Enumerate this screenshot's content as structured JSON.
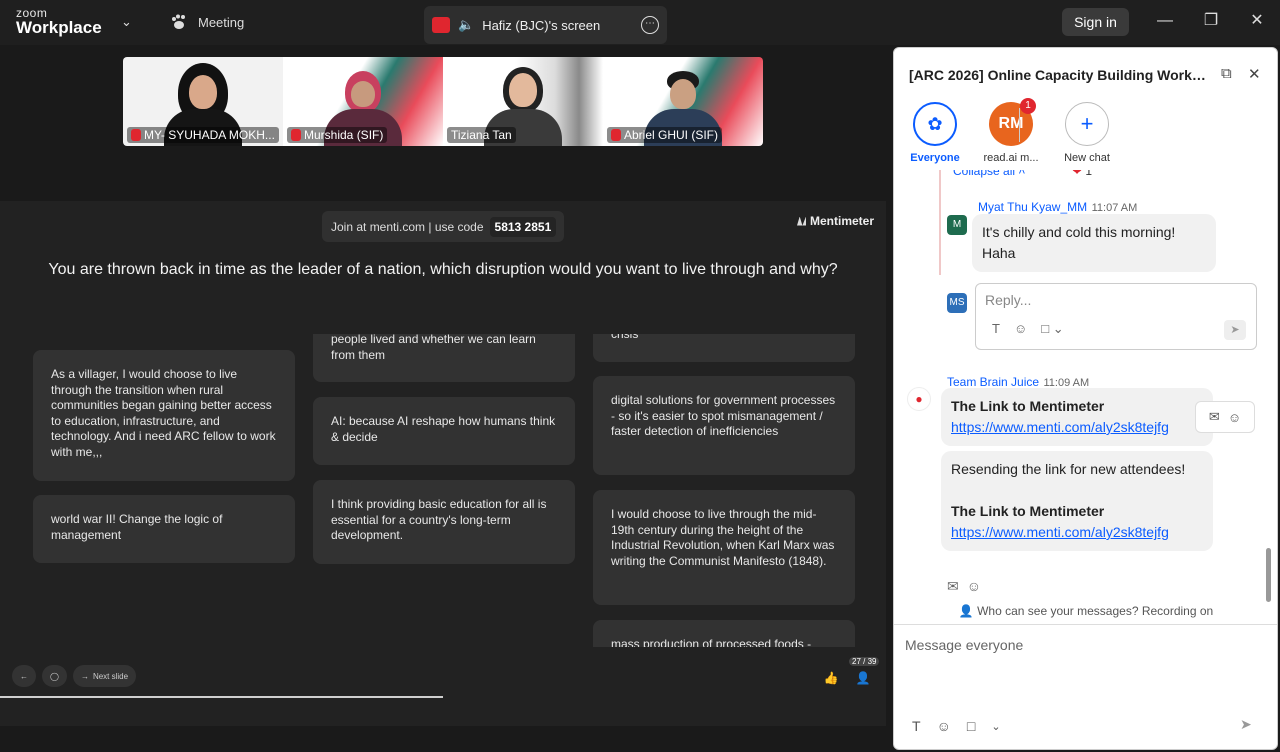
{
  "topbar": {
    "logo_top": "zoom",
    "logo_bottom": "Workplace",
    "meeting_label": "Meeting",
    "share_label": "Hafiz (BJC)'s screen",
    "signin_label": "Sign in"
  },
  "participants": [
    {
      "name": "MY- SYUHADA MOKH...",
      "muted": true
    },
    {
      "name": "Murshida (SIF)",
      "muted": true
    },
    {
      "name": "Tiziana Tan",
      "muted": false
    },
    {
      "name": "Abriel GHUI (SIF)",
      "muted": true
    }
  ],
  "slide": {
    "join_text": "Join at menti.com | use code",
    "code": "5813 2851",
    "brand": "Mentimeter",
    "question": "You are thrown back in time as the leader of a nation, which disruption would you want to live through and why?",
    "cards": [
      "As a villager, I would choose to live through the transition when rural communities began gaining better access to education, infrastructure, and technology. And i need ARC fellow to work with me,,,",
      "world war II! Change the logic of management",
      "people lived and whether we can learn from them",
      "AI: because AI reshape how humans think & decide",
      "I think providing basic education for all is essential for a country's long-term development.",
      "crisis",
      "digital solutions for government processes - so it's easier to spot mismanagement / faster detection of inefficiencies",
      "I would choose to live through the mid-19th century during the height of the Industrial Revolution, when Karl Marx was writing the Communist Manifesto (1848).",
      "mass production of processed foods -"
    ],
    "next_slide": "Next slide",
    "count": "27 / 39",
    "progress": 0.5
  },
  "chat": {
    "title": "[ARC 2026] Online Capacity Building Worksho...",
    "channels": [
      {
        "label": "Everyone"
      },
      {
        "label": "read.ai m...",
        "initials": "RM",
        "badge": "1"
      },
      {
        "label": "New chat"
      }
    ],
    "collapse": "Collapse all",
    "reaction_count": "1",
    "thread": {
      "sender": "Myat Thu Kyaw_MM",
      "time": "11:07 AM",
      "avatar": "M",
      "text": "It's chilly and cold this morning! Haha"
    },
    "reply_avatar": "MS",
    "reply_placeholder": "Reply...",
    "brainjuice": {
      "sender": "Team Brain Juice",
      "time": "11:09 AM",
      "msg1_title": "The Link to Mentimeter",
      "msg1_link": "https://www.menti.com/aly2sk8tejfg",
      "msg2_text": "Resending the link for new attendees!",
      "msg2_title": "The Link to Mentimeter",
      "msg2_link": "https://www.menti.com/aly2sk8tejfg"
    },
    "who_can_see": "Who can see your messages? Recording on",
    "input_placeholder": "Message everyone"
  }
}
